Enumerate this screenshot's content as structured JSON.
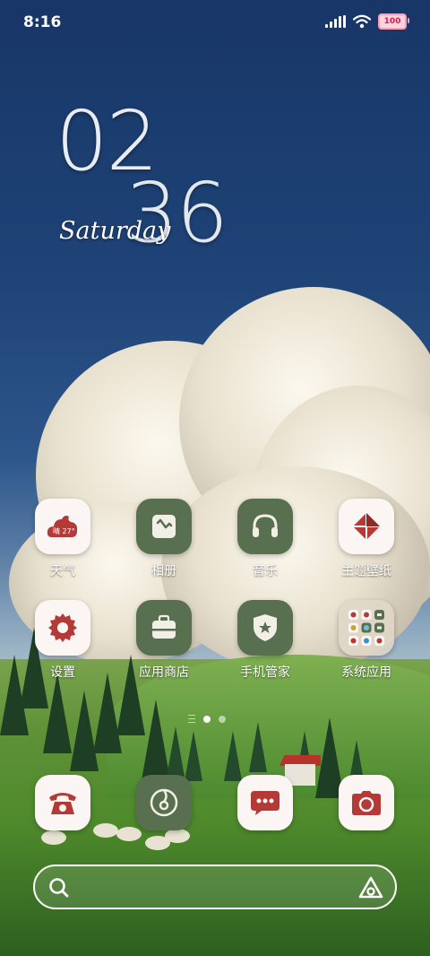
{
  "status_bar": {
    "time": "8:16",
    "battery": "100"
  },
  "clock_widget": {
    "hour": "02",
    "minute": "36",
    "day": "Saturday"
  },
  "apps": [
    {
      "label": "天气",
      "icon": "weather-icon",
      "icon_text": "晴 27°"
    },
    {
      "label": "相册",
      "icon": "gallery-icon"
    },
    {
      "label": "音乐",
      "icon": "music-icon"
    },
    {
      "label": "主题壁纸",
      "icon": "themes-icon"
    },
    {
      "label": "设置",
      "icon": "settings-icon"
    },
    {
      "label": "应用商店",
      "icon": "app-store-icon"
    },
    {
      "label": "手机管家",
      "icon": "phone-manager-icon"
    },
    {
      "label": "系统应用",
      "icon": "system-apps-folder-icon"
    }
  ],
  "dock": [
    {
      "icon": "phone-icon"
    },
    {
      "icon": "browser-icon"
    },
    {
      "icon": "messages-icon"
    },
    {
      "icon": "camera-icon"
    }
  ],
  "page_indicator": {
    "pages": 2,
    "current": 1
  },
  "colors": {
    "icon_red": "#b33a36",
    "icon_green": "#58704f",
    "icon_white": "#fbf6f3"
  }
}
